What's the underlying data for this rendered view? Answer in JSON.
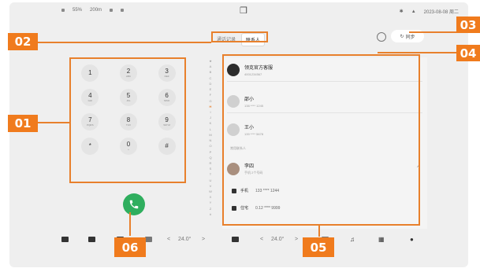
{
  "status_bar": {
    "left_items": [
      "[icon]",
      "55%",
      "200m"
    ],
    "center_logo": "❒",
    "right_items": [
      "✱",
      "▲",
      "2023-08-08 周二"
    ]
  },
  "tabs": [
    {
      "label": "通话记录",
      "active": false
    },
    {
      "label": "联系人",
      "active": true
    }
  ],
  "sync_button": {
    "icon": "refresh-icon",
    "label": "同步"
  },
  "keypad": [
    {
      "digit": "1",
      "letters": ""
    },
    {
      "digit": "2",
      "letters": "ABC"
    },
    {
      "digit": "3",
      "letters": "DEF"
    },
    {
      "digit": "4",
      "letters": "GHI"
    },
    {
      "digit": "5",
      "letters": "JKL"
    },
    {
      "digit": "6",
      "letters": "MNO"
    },
    {
      "digit": "7",
      "letters": "PQRS"
    },
    {
      "digit": "8",
      "letters": "TUV"
    },
    {
      "digit": "9",
      "letters": "WXYZ"
    },
    {
      "digit": "*",
      "letters": ""
    },
    {
      "digit": "0",
      "letters": "+"
    },
    {
      "digit": "#",
      "letters": ""
    }
  ],
  "alphabet_index": [
    "★",
    "A",
    "B",
    "C",
    "D",
    "E",
    "F",
    "G",
    "H",
    "I",
    "J",
    "K",
    "L",
    "M",
    "N",
    "O",
    "P",
    "Q",
    "R",
    "S",
    "T",
    "U",
    "V",
    "W",
    "X",
    "Y",
    "Z",
    "#"
  ],
  "alphabet_highlight": "H",
  "contacts": {
    "top": {
      "name": "领克官方客服",
      "sub": "4001234567"
    },
    "section1": {
      "name": "邵小",
      "sub": "138 **** 1245"
    },
    "section2": {
      "name": "王小",
      "sub": "139 **** 5678"
    },
    "section_label": "常用联系人",
    "expanded": {
      "name": "李四",
      "sub": "手机 2个号码",
      "chev": "^"
    },
    "phones": [
      {
        "type": "手机",
        "number": "133 **** 1244"
      },
      {
        "type": "住宅",
        "number": "0.12 **** 9999"
      }
    ]
  },
  "dock": {
    "temp_left": "24.0°",
    "temp_right": "24.0°",
    "arrow_left_prev": "<",
    "arrow_left_next": ">",
    "arrow_right_prev": "<",
    "arrow_right_next": ">"
  },
  "annotations": {
    "keypad": "01",
    "tabs": "02",
    "sync": "03",
    "settings": "04",
    "contacts": "05",
    "call": "06"
  },
  "colors": {
    "accent": "#f07b1d",
    "call_green": "#2fae5e"
  }
}
